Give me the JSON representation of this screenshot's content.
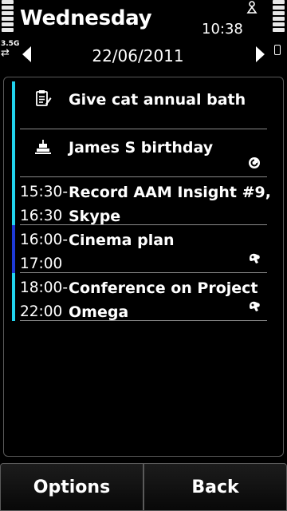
{
  "status": {
    "network_type": "3.5G",
    "time": "10:38"
  },
  "header": {
    "day": "Wednesday",
    "date": "22/06/2011"
  },
  "entries": [
    {
      "start": "",
      "end": "",
      "subject_line1": "Give cat annual bath",
      "subject_line2": "",
      "icon": "todo-icon",
      "status_icon": "",
      "bar_color": "#22d3ee"
    },
    {
      "start": "",
      "end": "",
      "subject_line1": "James S birthday",
      "subject_line2": "",
      "icon": "anniversary-icon",
      "status_icon": "repeat-icon",
      "bar_color": "#22d3ee"
    },
    {
      "start": "15:30-",
      "end": "16:30",
      "subject_line1": "Record AAM Insight #9,",
      "subject_line2": "Skype",
      "icon": "",
      "status_icon": "",
      "bar_color": "#22d3ee"
    },
    {
      "start": "16:00-",
      "end": "17:00",
      "subject_line1": "Cinema plan",
      "subject_line2": "",
      "icon": "",
      "status_icon": "alarm-icon",
      "bar_color": "#1e3ad6"
    },
    {
      "start": "18:00-",
      "end": "22:00",
      "subject_line1": "Conference on Project",
      "subject_line2": "Omega",
      "icon": "",
      "status_icon": "alarm-icon",
      "bar_color": "#22d3ee"
    }
  ],
  "softkeys": {
    "left": "Options",
    "right": "Back"
  }
}
